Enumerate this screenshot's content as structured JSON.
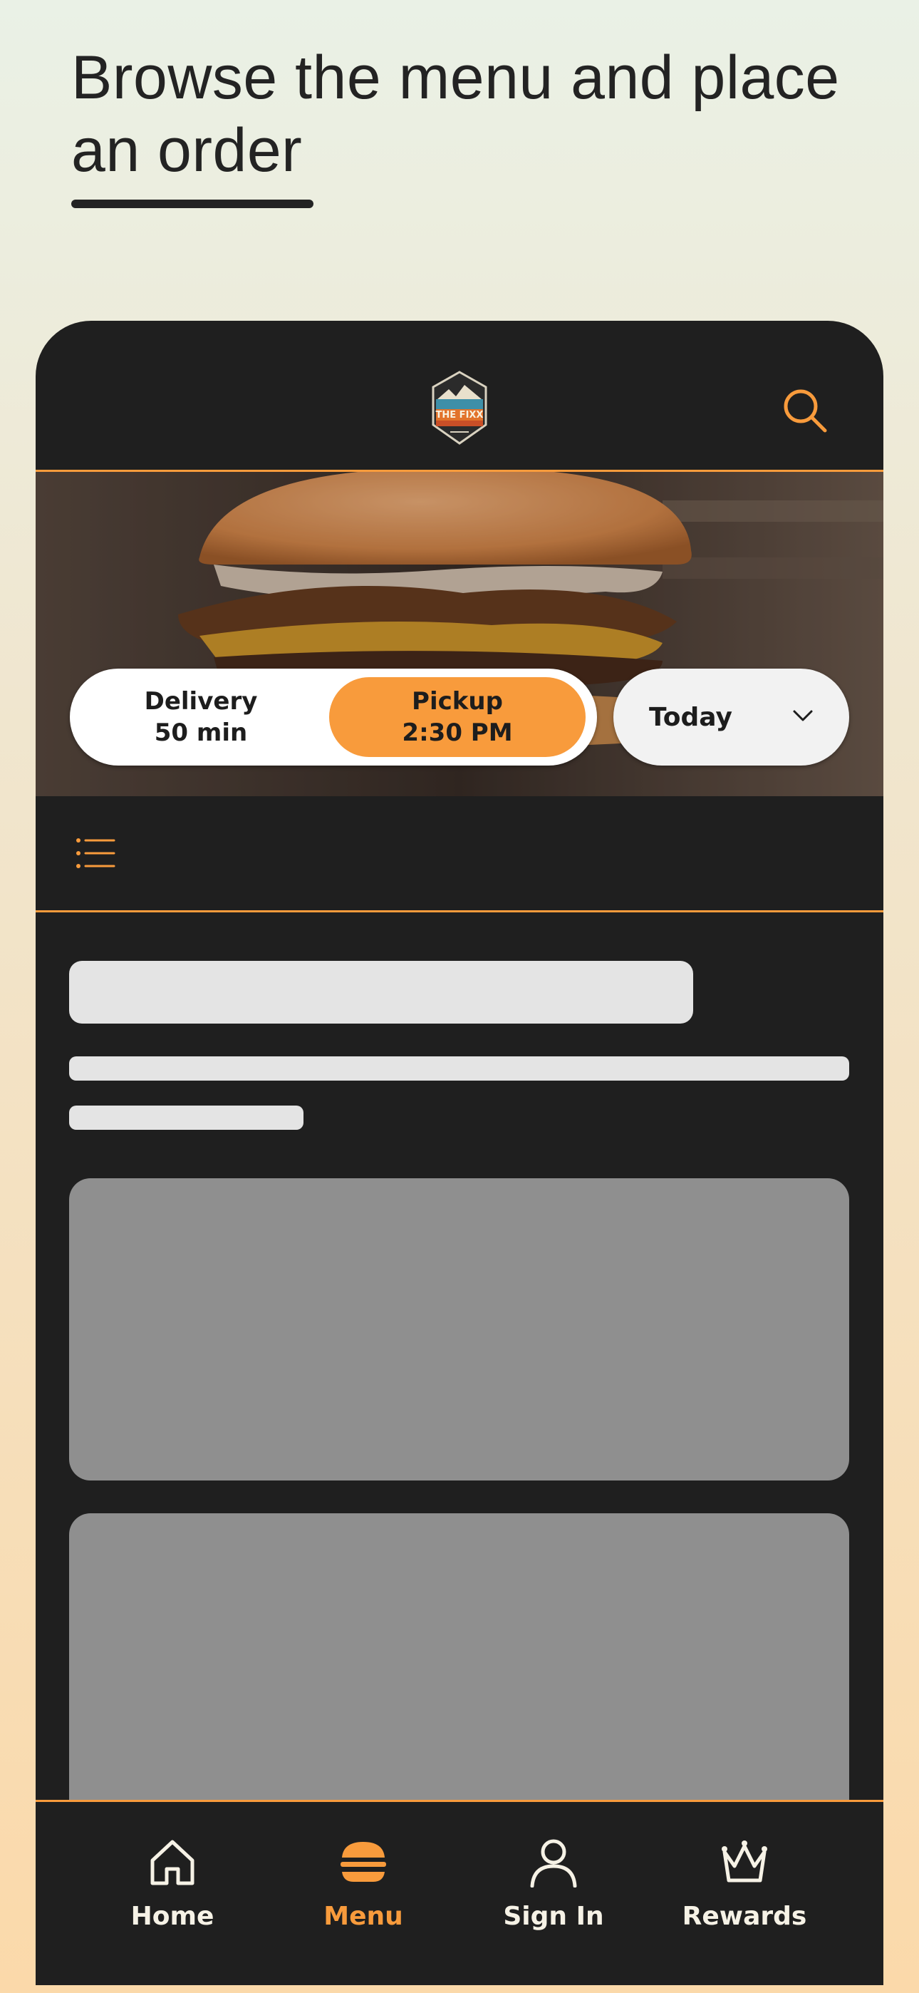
{
  "headline": {
    "text": "Browse the menu and place an order"
  },
  "header": {
    "logo_text": "THE FIXX",
    "search_icon": "search-icon"
  },
  "order_mode": {
    "delivery_label": "Delivery",
    "delivery_time": "50 min",
    "pickup_label": "Pickup",
    "pickup_time": "2:30 PM",
    "selected": "pickup"
  },
  "day_select": {
    "value": "Today",
    "icon": "chevron-down-icon"
  },
  "category_bar": {
    "icon": "list-icon"
  },
  "tabs": [
    {
      "label": "Home",
      "icon": "home-icon",
      "active": false
    },
    {
      "label": "Menu",
      "icon": "burger-icon",
      "active": true
    },
    {
      "label": "Sign In",
      "icon": "user-icon",
      "active": false
    },
    {
      "label": "Rewards",
      "icon": "crown-icon",
      "active": false
    }
  ],
  "colors": {
    "accent": "#f89b3c",
    "app_background": "#1f1f1f",
    "skeleton_light": "#e4e4e4",
    "skeleton_dark": "#8f8f8f"
  }
}
